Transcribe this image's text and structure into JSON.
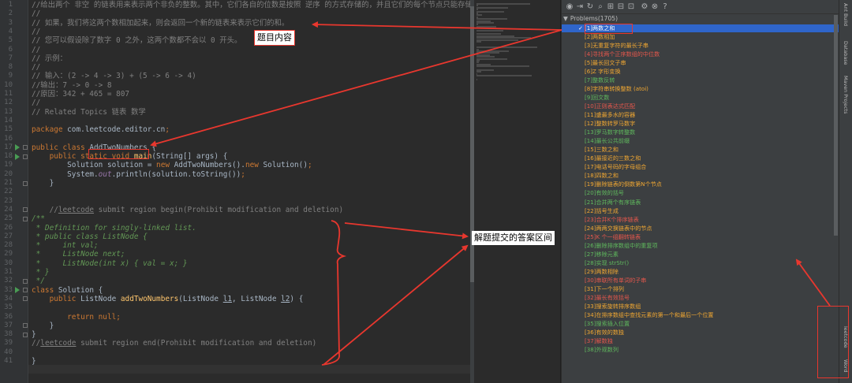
{
  "editor": {
    "lines": [
      {
        "n": "1",
        "parts": [
          {
            "t": "//给出两个 非空 的链表用来表示两个非负的整数。其中，它们各自的位数是按照 逆序 的方式存储的，并且它们的每个节点只能存储",
            "c": "c-com"
          }
        ]
      },
      {
        "n": "2",
        "parts": [
          {
            "t": "//",
            "c": "c-com"
          }
        ]
      },
      {
        "n": "3",
        "parts": [
          {
            "t": "// 如果，我们将这两个数相加起来，则会返回一个新的链表来表示它们的和。",
            "c": "c-com"
          }
        ]
      },
      {
        "n": "4",
        "parts": [
          {
            "t": "//",
            "c": "c-com"
          }
        ]
      },
      {
        "n": "5",
        "parts": [
          {
            "t": "// 您可以假设除了数字 0 之外，这两个数都不会以 0 开头。",
            "c": "c-com"
          }
        ]
      },
      {
        "n": "6",
        "parts": [
          {
            "t": "//",
            "c": "c-com"
          }
        ]
      },
      {
        "n": "7",
        "parts": [
          {
            "t": "// 示例：",
            "c": "c-com"
          }
        ]
      },
      {
        "n": "8",
        "parts": [
          {
            "t": "//",
            "c": "c-com"
          }
        ]
      },
      {
        "n": "9",
        "parts": [
          {
            "t": "// 输入：(2 -> 4 -> 3) + (5 -> 6 -> 4)",
            "c": "c-com"
          }
        ]
      },
      {
        "n": "10",
        "parts": [
          {
            "t": "//输出：7 -> 0 -> 8",
            "c": "c-com"
          }
        ]
      },
      {
        "n": "11",
        "parts": [
          {
            "t": "//原因：342 + 465 = 807",
            "c": "c-com"
          }
        ]
      },
      {
        "n": "12",
        "parts": [
          {
            "t": "//",
            "c": "c-com"
          }
        ]
      },
      {
        "n": "13",
        "parts": [
          {
            "t": "// Related Topics 链表 数学",
            "c": "c-com"
          }
        ]
      },
      {
        "n": "14",
        "parts": [
          {
            "t": "",
            "c": ""
          }
        ]
      },
      {
        "n": "15",
        "parts": [
          {
            "t": "package ",
            "c": "c-kw"
          },
          {
            "t": "com.leetcode.editor.cn",
            "c": ""
          },
          {
            "t": ";",
            "c": "c-kw"
          }
        ]
      },
      {
        "n": "16",
        "parts": [
          {
            "t": "",
            "c": ""
          }
        ]
      },
      {
        "n": "17",
        "parts": [
          {
            "t": "public class ",
            "c": "c-kw"
          },
          {
            "t": "AddTwoNumbers",
            "c": ""
          },
          {
            "t": " {",
            "c": ""
          }
        ]
      },
      {
        "n": "18",
        "parts": [
          {
            "t": "    public static void ",
            "c": "c-kw"
          },
          {
            "t": "main",
            "c": "c-fn"
          },
          {
            "t": "(String[] args) {",
            "c": ""
          }
        ]
      },
      {
        "n": "19",
        "parts": [
          {
            "t": "        Solution solution = ",
            "c": ""
          },
          {
            "t": "new ",
            "c": "c-kw"
          },
          {
            "t": "AddTwoNumbers().",
            "c": ""
          },
          {
            "t": "new ",
            "c": "c-kw"
          },
          {
            "t": "Solution()",
            "c": ""
          },
          {
            "t": ";",
            "c": "c-kw"
          }
        ]
      },
      {
        "n": "20",
        "parts": [
          {
            "t": "        System.",
            "c": ""
          },
          {
            "t": "out",
            "c": "c-st"
          },
          {
            "t": ".println(solution.toString())",
            "c": ""
          },
          {
            "t": ";",
            "c": "c-kw"
          }
        ]
      },
      {
        "n": "21",
        "parts": [
          {
            "t": "    }",
            "c": ""
          }
        ]
      },
      {
        "n": "22",
        "parts": [
          {
            "t": "",
            "c": ""
          }
        ]
      },
      {
        "n": "23",
        "parts": [
          {
            "t": "",
            "c": ""
          }
        ]
      },
      {
        "n": "24",
        "parts": [
          {
            "t": "    //",
            "c": "c-com"
          },
          {
            "t": "leetcode",
            "c": "c-com c-ul"
          },
          {
            "t": " submit region begin(Prohibit modification and deletion)",
            "c": "c-com"
          }
        ]
      },
      {
        "n": "25",
        "parts": [
          {
            "t": "/**",
            "c": "c-doc"
          }
        ]
      },
      {
        "n": "26",
        "parts": [
          {
            "t": " * Definition for singly-linked list.",
            "c": "c-doc"
          }
        ]
      },
      {
        "n": "27",
        "parts": [
          {
            "t": " * public class ListNode {",
            "c": "c-doc"
          }
        ]
      },
      {
        "n": "28",
        "parts": [
          {
            "t": " *     int val;",
            "c": "c-doc"
          }
        ]
      },
      {
        "n": "29",
        "parts": [
          {
            "t": " *     ListNode next;",
            "c": "c-doc"
          }
        ]
      },
      {
        "n": "30",
        "parts": [
          {
            "t": " *     ListNode(int x) { val = x; }",
            "c": "c-doc"
          }
        ]
      },
      {
        "n": "31",
        "parts": [
          {
            "t": " * }",
            "c": "c-doc"
          }
        ]
      },
      {
        "n": "32",
        "parts": [
          {
            "t": " */",
            "c": "c-doc"
          }
        ]
      },
      {
        "n": "33",
        "parts": [
          {
            "t": "class ",
            "c": "c-kw"
          },
          {
            "t": "Solution {",
            "c": ""
          }
        ]
      },
      {
        "n": "34",
        "parts": [
          {
            "t": "    public ",
            "c": "c-kw"
          },
          {
            "t": "ListNode ",
            "c": ""
          },
          {
            "t": "addTwoNumbers",
            "c": "c-fn"
          },
          {
            "t": "(ListNode ",
            "c": ""
          },
          {
            "t": "l1",
            "c": "c-par"
          },
          {
            "t": ", ListNode ",
            "c": ""
          },
          {
            "t": "l2",
            "c": "c-par"
          },
          {
            "t": ") {",
            "c": ""
          }
        ]
      },
      {
        "n": "35",
        "parts": [
          {
            "t": "",
            "c": ""
          }
        ]
      },
      {
        "n": "36",
        "parts": [
          {
            "t": "        return null",
            "c": "c-kw"
          },
          {
            "t": ";",
            "c": "c-kw"
          }
        ]
      },
      {
        "n": "37",
        "parts": [
          {
            "t": "    }",
            "c": ""
          }
        ]
      },
      {
        "n": "38",
        "parts": [
          {
            "t": "}",
            "c": ""
          }
        ]
      },
      {
        "n": "39",
        "parts": [
          {
            "t": "//",
            "c": "c-com"
          },
          {
            "t": "leetcode",
            "c": "c-com c-ul"
          },
          {
            "t": " submit region end(Prohibit modification and deletion)",
            "c": "c-com"
          }
        ]
      },
      {
        "n": "40",
        "parts": [
          {
            "t": "",
            "c": ""
          }
        ]
      },
      {
        "n": "41",
        "parts": [
          {
            "t": "}",
            "c": ""
          }
        ]
      }
    ]
  },
  "panel": {
    "toolbar_icons": [
      "login-icon",
      "logout-icon",
      "refresh-icon",
      "search-icon",
      "expand-icon",
      "collapse-icon",
      "find-icon",
      "settings-icon",
      "close-icon",
      "help-icon"
    ],
    "root_label": "Problems(1705)",
    "selected_check": "✓",
    "problems": [
      {
        "t": "[1]两数之和",
        "d": "easy",
        "sel": true
      },
      {
        "t": "[2]两数相加",
        "d": "medium"
      },
      {
        "t": "[3]无重复字符的最长子串",
        "d": "medium"
      },
      {
        "t": "[4]寻找两个正序数组的中位数",
        "d": "hard"
      },
      {
        "t": "[5]最长回文子串",
        "d": "medium"
      },
      {
        "t": "[6]Z 字形变换",
        "d": "medium"
      },
      {
        "t": "[7]整数反转",
        "d": "easy"
      },
      {
        "t": "[8]字符串转换整数 (atoi)",
        "d": "medium"
      },
      {
        "t": "[9]回文数",
        "d": "easy"
      },
      {
        "t": "[10]正则表达式匹配",
        "d": "hard"
      },
      {
        "t": "[11]盛最多水的容器",
        "d": "medium"
      },
      {
        "t": "[12]整数转罗马数字",
        "d": "medium"
      },
      {
        "t": "[13]罗马数字转整数",
        "d": "easy"
      },
      {
        "t": "[14]最长公共前缀",
        "d": "easy"
      },
      {
        "t": "[15]三数之和",
        "d": "medium"
      },
      {
        "t": "[16]最接近的三数之和",
        "d": "medium"
      },
      {
        "t": "[17]电话号码的字母组合",
        "d": "medium"
      },
      {
        "t": "[18]四数之和",
        "d": "medium"
      },
      {
        "t": "[19]删除链表的倒数第N个节点",
        "d": "medium"
      },
      {
        "t": "[20]有效的括号",
        "d": "easy"
      },
      {
        "t": "[21]合并两个有序链表",
        "d": "easy"
      },
      {
        "t": "[22]括号生成",
        "d": "medium"
      },
      {
        "t": "[23]合并K个排序链表",
        "d": "hard"
      },
      {
        "t": "[24]两两交换链表中的节点",
        "d": "medium"
      },
      {
        "t": "[25]K 个一组翻转链表",
        "d": "hard"
      },
      {
        "t": "[26]删除排序数组中的重复项",
        "d": "easy"
      },
      {
        "t": "[27]移除元素",
        "d": "easy"
      },
      {
        "t": "[28]实现 strStr()",
        "d": "easy"
      },
      {
        "t": "[29]两数相除",
        "d": "medium"
      },
      {
        "t": "[30]串联所有单词的子串",
        "d": "hard"
      },
      {
        "t": "[31]下一个排列",
        "d": "medium"
      },
      {
        "t": "[32]最长有效括号",
        "d": "hard"
      },
      {
        "t": "[33]搜索旋转排序数组",
        "d": "medium"
      },
      {
        "t": "[34]在排序数组中查找元素的第一个和最后一个位置",
        "d": "medium"
      },
      {
        "t": "[35]搜索插入位置",
        "d": "easy"
      },
      {
        "t": "[36]有效的数独",
        "d": "medium"
      },
      {
        "t": "[37]解数独",
        "d": "hard"
      },
      {
        "t": "[38]外观数列",
        "d": "easy"
      }
    ]
  },
  "rightbar": {
    "tabs": [
      {
        "name": "ant-build-tab",
        "label": "Ant Build"
      },
      {
        "name": "database-tab",
        "label": "Database"
      },
      {
        "name": "maven-projects-tab",
        "label": "Maven Projects"
      },
      {
        "name": "leetcode-tab",
        "label": "leetcode"
      },
      {
        "name": "word-tab",
        "label": "Word"
      }
    ]
  },
  "annotations": {
    "problem_content": "题目内容",
    "answer_region": "解题提交的答案区间"
  },
  "colors": {
    "annotation": "#e8372e",
    "selection": "#2f65ca",
    "easy": "#5fb85d",
    "medium": "#f0a732",
    "hard": "#e5574c"
  }
}
